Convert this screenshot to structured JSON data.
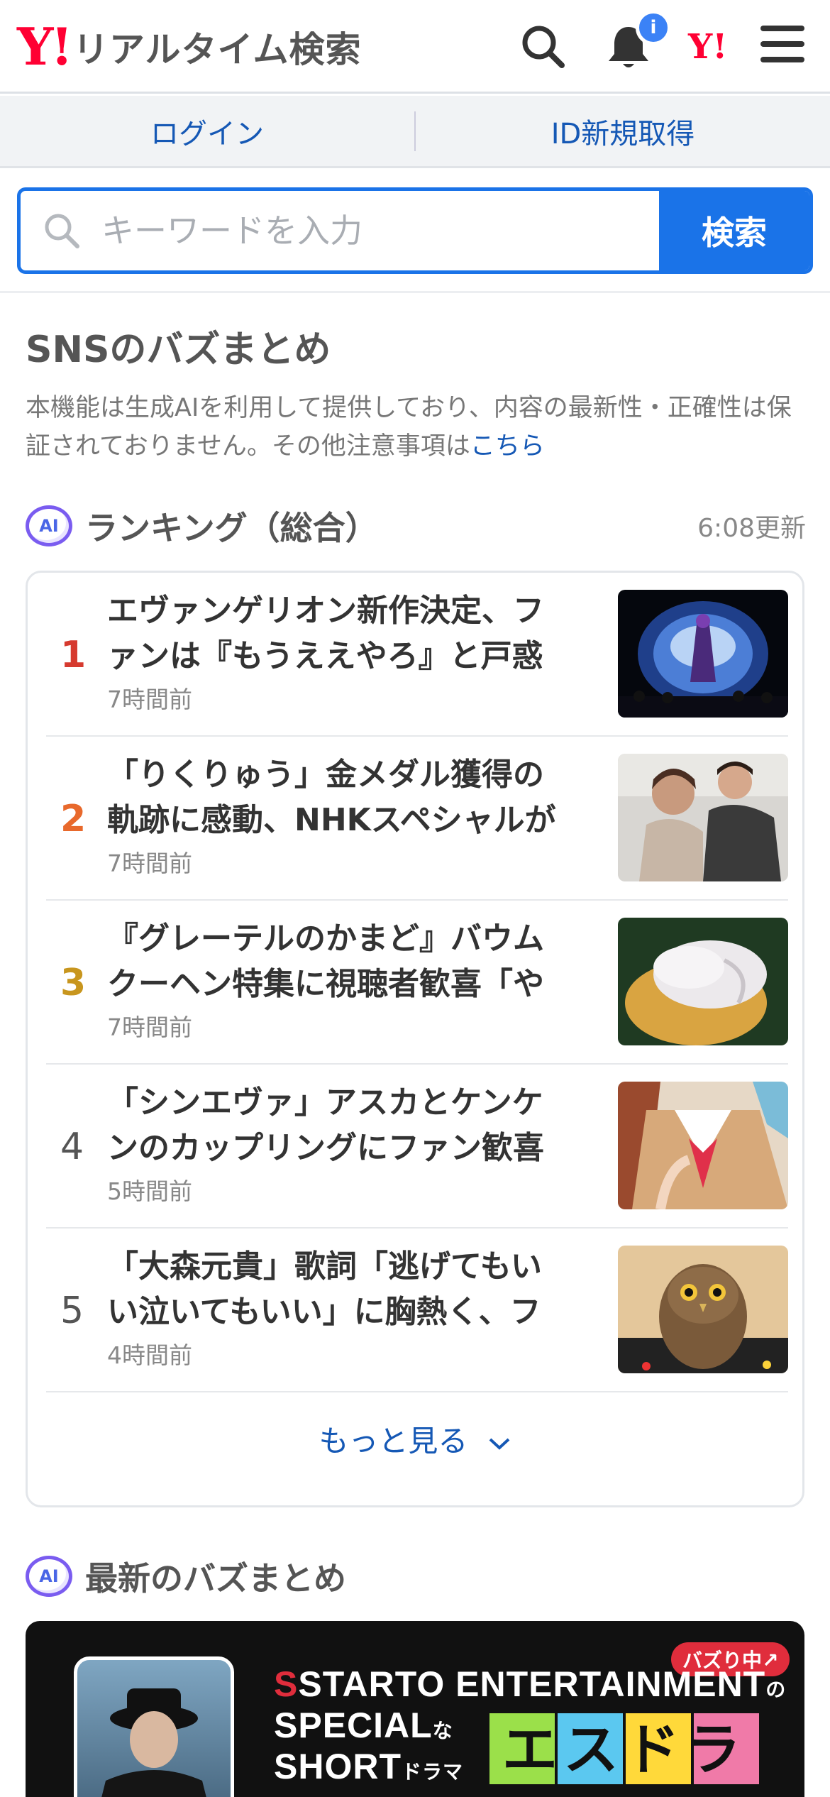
{
  "header": {
    "logo_mark": "Y!",
    "logo_text": "リアルタイム検索",
    "notification_badge": "i",
    "ylogo": "Y!"
  },
  "login_bar": {
    "login": "ログイン",
    "signup": "ID新規取得"
  },
  "search": {
    "placeholder": "キーワードを入力",
    "button": "検索"
  },
  "section": {
    "title": "SNSのバズまとめ",
    "disclaimer": "本機能は生成AIを利用して提供しており、内容の最新性・正確性は保証されておりません。その他注意事項は",
    "disclaimer_link": "こちら"
  },
  "ranking": {
    "ai_label": "AI",
    "title": "ランキング（総合）",
    "updated": "6:08更新",
    "items": [
      {
        "rank": "1",
        "headline": "エヴァンゲリオン新作決定、ファンは『もうええやろ』と戸惑い…",
        "time": "7時間前",
        "color": "#d63a2f"
      },
      {
        "rank": "2",
        "headline": "「りくりゅう」金メダル獲得の軌跡に感動、NHKスペシャルが話…",
        "time": "7時間前",
        "color": "#e8692c"
      },
      {
        "rank": "3",
        "headline": "『グレーテルのかまど』バウムクーヘン特集に視聴者歓喜「やば…",
        "time": "7時間前",
        "color": "#c8961e"
      },
      {
        "rank": "4",
        "headline": "「シンエヴァ」アスカとケンケンのカップリングにファン歓喜と…",
        "time": "5時間前",
        "color": "#555555"
      },
      {
        "rank": "5",
        "headline": "「大森元貴」歌詞「逃げてもいい泣いてもいい」に胸熱く、ファ…",
        "time": "4時間前",
        "color": "#555555"
      }
    ],
    "more": "もっと見る"
  },
  "latest": {
    "ai_label": "AI",
    "title": "最新のバズまとめ",
    "banner": {
      "line1": "STARTO ENTERTAINMENT",
      "line1_suffix": "の",
      "line2": "SPECIAL",
      "line2_suffix": "な",
      "line3": "SHORT",
      "line3_suffix": "ドラマ",
      "tag": "バズり中↗",
      "logo": "エスドラ"
    }
  }
}
